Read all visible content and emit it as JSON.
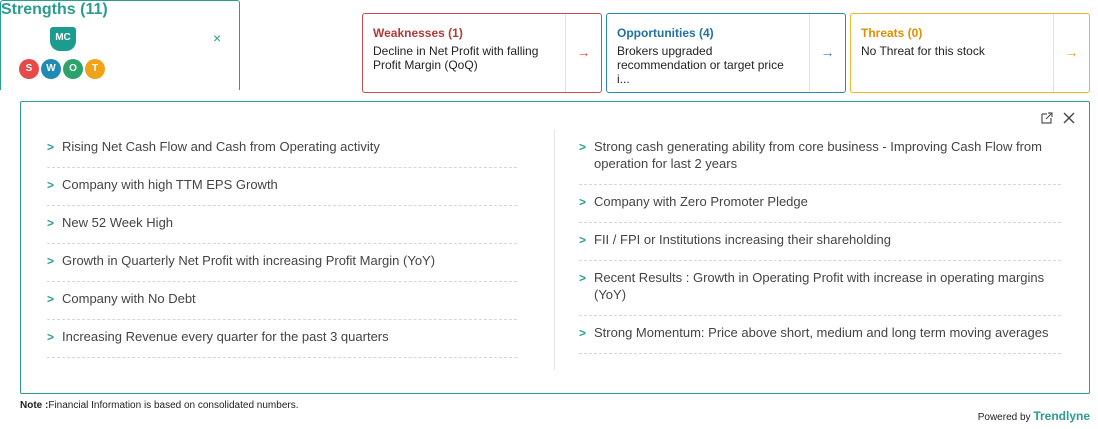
{
  "logo": {
    "mc": "MC",
    "letters": [
      "S",
      "W",
      "O",
      "T"
    ]
  },
  "tabs": {
    "strengths": {
      "title": "Strengths (11)",
      "close": "×"
    },
    "weaknesses": {
      "title": "Weaknesses (1)",
      "desc": "Decline in Net Profit with falling Profit Margin (QoQ)",
      "arrow": "→"
    },
    "opportunities": {
      "title": "Opportunities (4)",
      "desc": "Brokers upgraded recommendation or target price i...",
      "arrow": "→"
    },
    "threats": {
      "title": "Threats (0)",
      "desc": "No Threat for this stock",
      "arrow": "→"
    }
  },
  "panel": {
    "left_items": [
      "Rising Net Cash Flow and Cash from Operating activity",
      "Company with high TTM EPS Growth",
      "New 52 Week High",
      "Growth in Quarterly Net Profit with increasing Profit Margin (YoY)",
      "Company with No Debt",
      "Increasing Revenue every quarter for the past 3 quarters"
    ],
    "right_items": [
      "Strong cash generating ability from core business - Improving Cash Flow from operation for last 2 years",
      "Company with Zero Promoter Pledge",
      "FII / FPI or Institutions increasing their shareholding",
      "Recent Results : Growth in Operating Profit with increase in operating margins (YoY)",
      "Strong Momentum: Price above short, medium and long term moving averages"
    ]
  },
  "footer": {
    "note_label": "Note :",
    "note_text": "Financial Information is based on consolidated numbers.",
    "powered_by": "Powered by",
    "brand": "Trendlyne"
  }
}
